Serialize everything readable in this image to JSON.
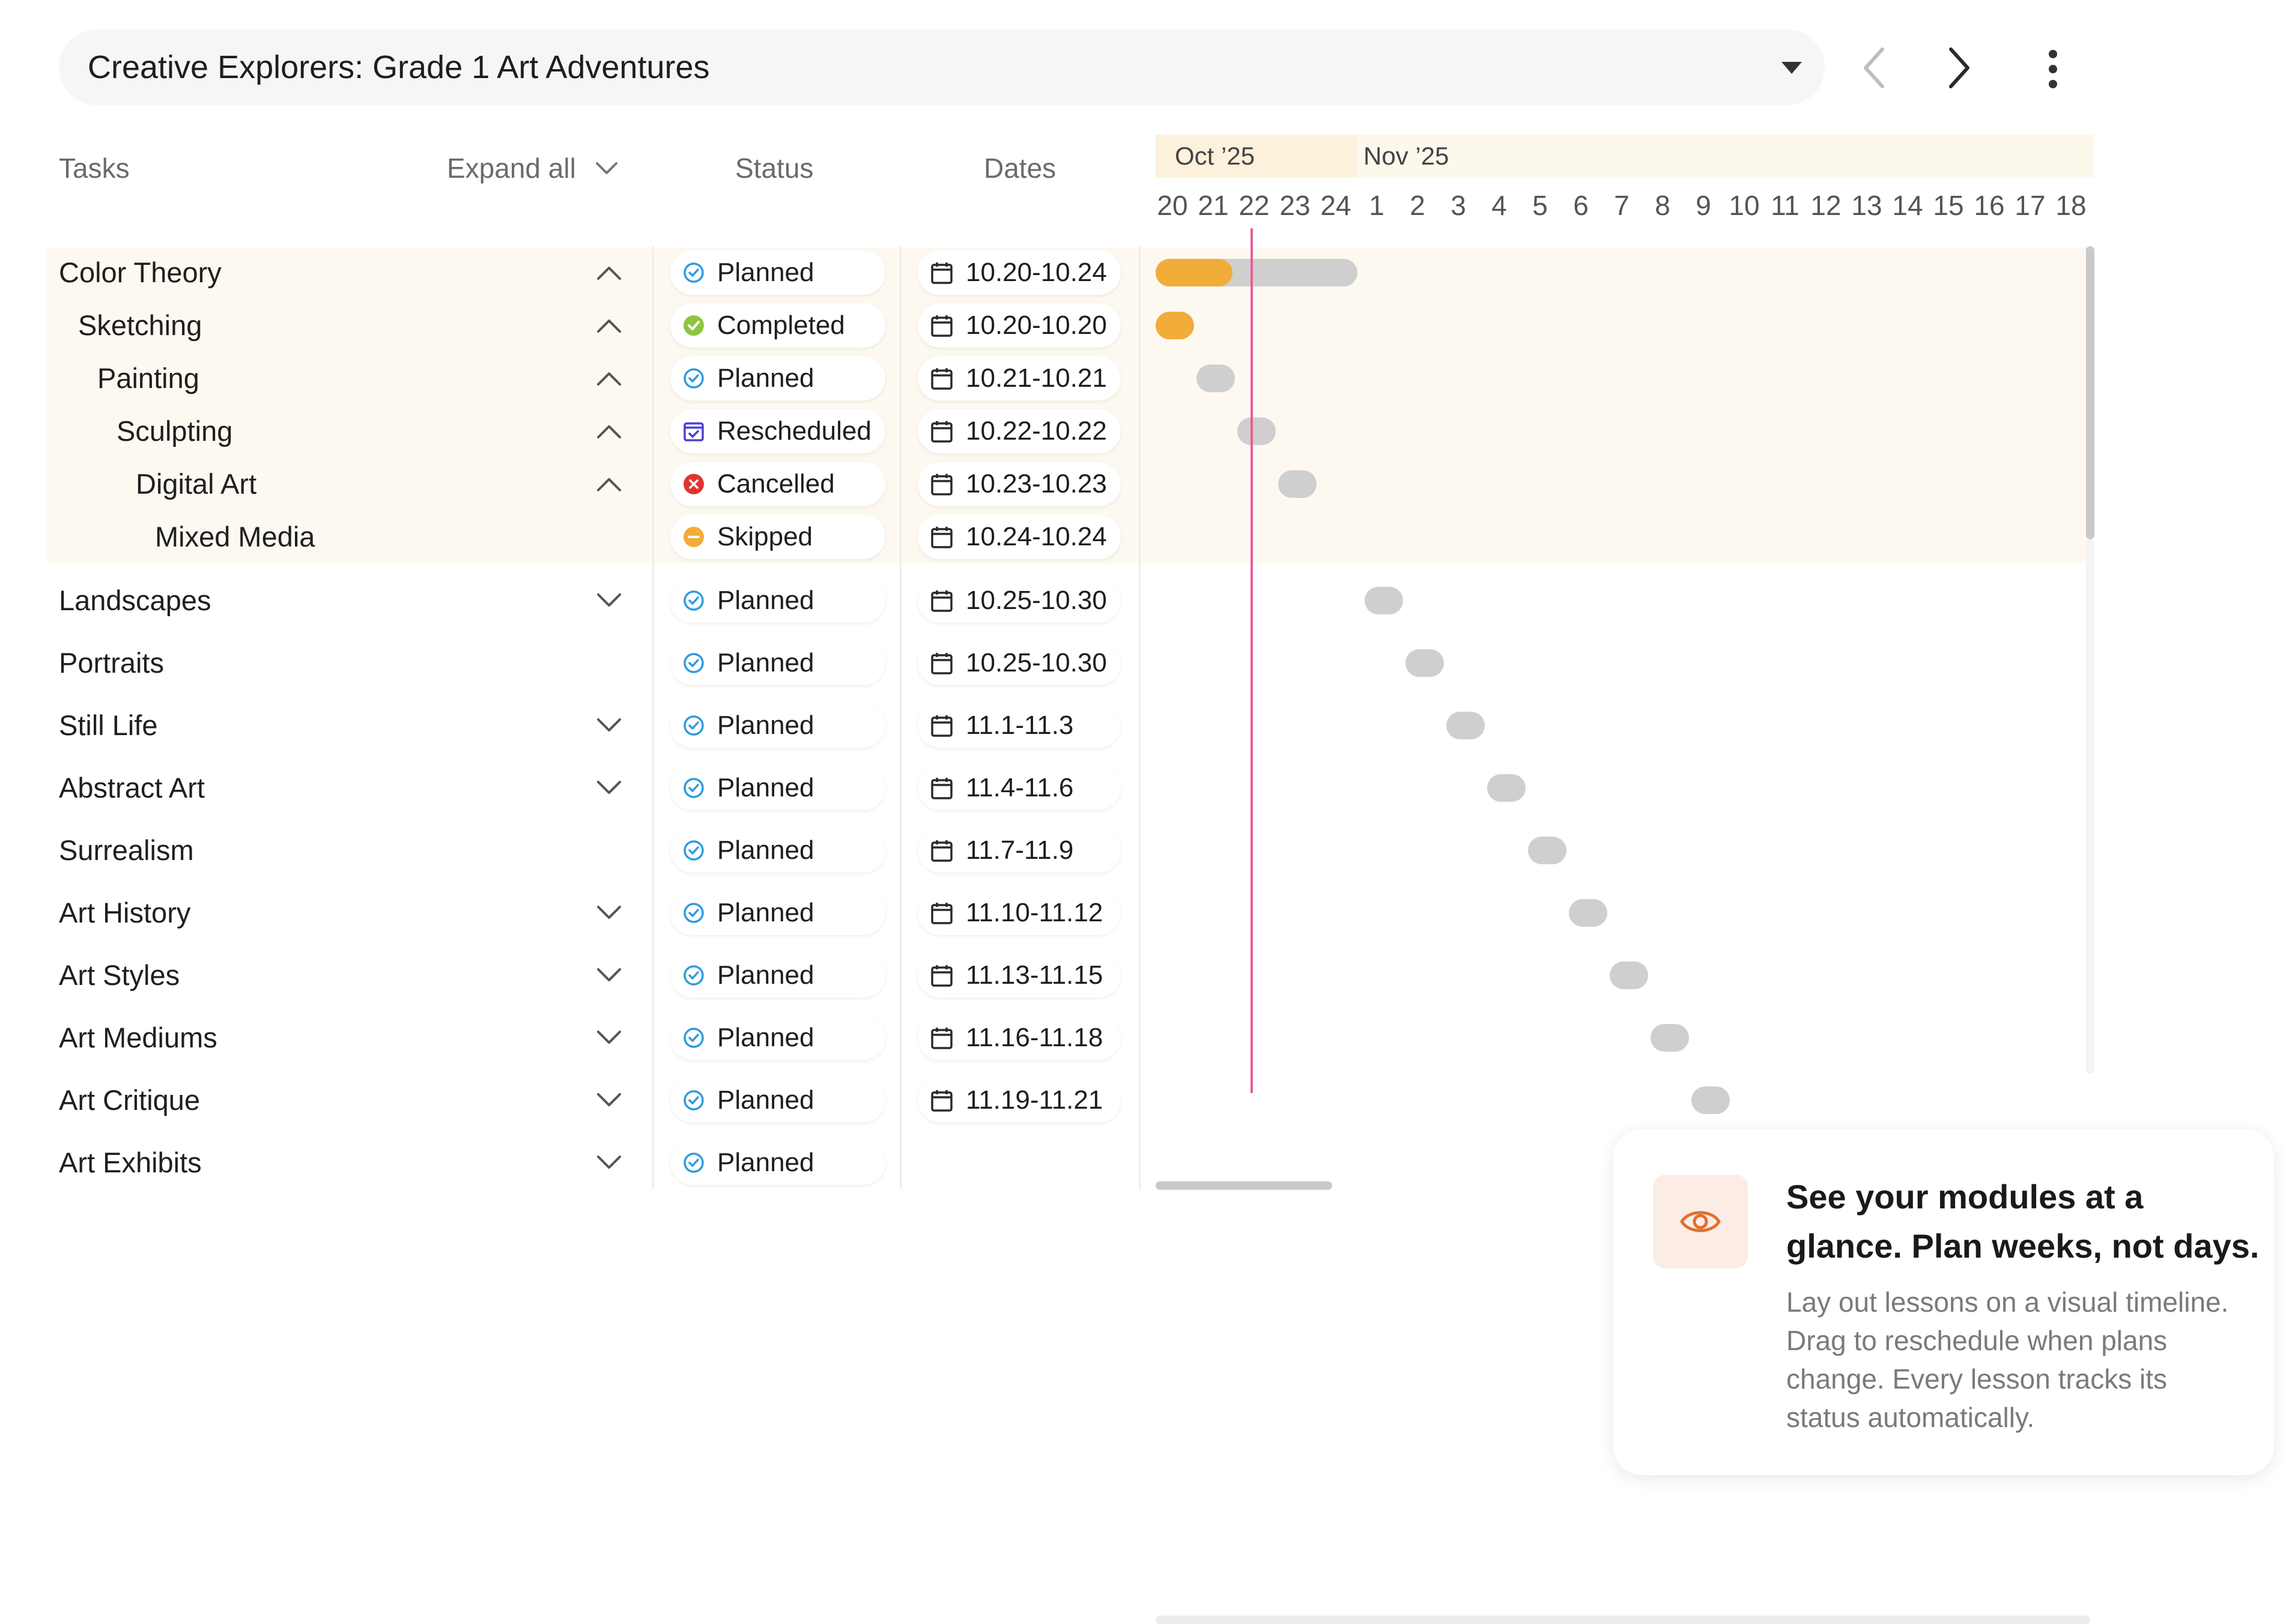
{
  "header": {
    "project_title": "Creative Explorers: Grade 1 Art Adventures"
  },
  "columns": {
    "tasks": "Tasks",
    "expand_all": "Expand all",
    "status": "Status",
    "dates": "Dates"
  },
  "timeline": {
    "month_oct": "Oct ’25",
    "month_nov": "Nov ’25",
    "days": [
      "20",
      "21",
      "22",
      "23",
      "24",
      "1",
      "2",
      "3",
      "4",
      "5",
      "6",
      "7",
      "8",
      "9",
      "10",
      "11",
      "12",
      "13",
      "14",
      "15",
      "16",
      "17",
      "18"
    ]
  },
  "tasks": [
    {
      "label": "Color Theory",
      "status": "Planned",
      "dates": "10.20-10.24",
      "chevron": "up"
    },
    {
      "label": "Sketching",
      "status": "Completed",
      "dates": "10.20-10.20",
      "chevron": "up"
    },
    {
      "label": "Painting",
      "status": "Planned",
      "dates": "10.21-10.21",
      "chevron": "up"
    },
    {
      "label": "Sculpting",
      "status": "Rescheduled",
      "dates": "10.22-10.22",
      "chevron": "up"
    },
    {
      "label": "Digital Art",
      "status": "Cancelled",
      "dates": "10.23-10.23",
      "chevron": "up"
    },
    {
      "label": "Mixed Media",
      "status": "Skipped",
      "dates": "10.24-10.24",
      "chevron": "none"
    },
    {
      "label": "Landscapes",
      "status": "Planned",
      "dates": "10.25-10.30",
      "chevron": "down"
    },
    {
      "label": "Portraits",
      "status": "Planned",
      "dates": "10.25-10.30",
      "chevron": "none"
    },
    {
      "label": "Still Life",
      "status": "Planned",
      "dates": "11.1-11.3",
      "chevron": "down"
    },
    {
      "label": "Abstract Art",
      "status": "Planned",
      "dates": "11.4-11.6",
      "chevron": "down"
    },
    {
      "label": "Surrealism",
      "status": "Planned",
      "dates": "11.7-11.9",
      "chevron": "none"
    },
    {
      "label": "Art History",
      "status": "Planned",
      "dates": "11.10-11.12",
      "chevron": "down"
    },
    {
      "label": "Art Styles",
      "status": "Planned",
      "dates": "11.13-11.15",
      "chevron": "down"
    },
    {
      "label": "Art Mediums",
      "status": "Planned",
      "dates": "11.16-11.18",
      "chevron": "down"
    },
    {
      "label": "Art Critique",
      "status": "Planned",
      "dates": "11.19-11.21",
      "chevron": "down"
    },
    {
      "label": "Art Exhibits",
      "status": "Planned",
      "dates": "",
      "chevron": "down"
    }
  ],
  "status_colors": {
    "Planned": "#2f9be0",
    "Completed": "#8cc63f",
    "Rescheduled": "#4b3fd6",
    "Cancelled": "#e0342e",
    "Skipped": "#f2ac3a"
  },
  "colors": {
    "progress": "#f2ac3a",
    "bar": "#cfcfcf",
    "today_line": "#e3609a",
    "highlight": "#fdf9f0"
  },
  "card": {
    "title": "See your modules at a glance. Plan weeks, not days.",
    "body": "Lay out lessons on a visual timeline. Drag to reschedule when plans change. Every lesson tracks its status automatically.",
    "icon": "eye-icon"
  }
}
